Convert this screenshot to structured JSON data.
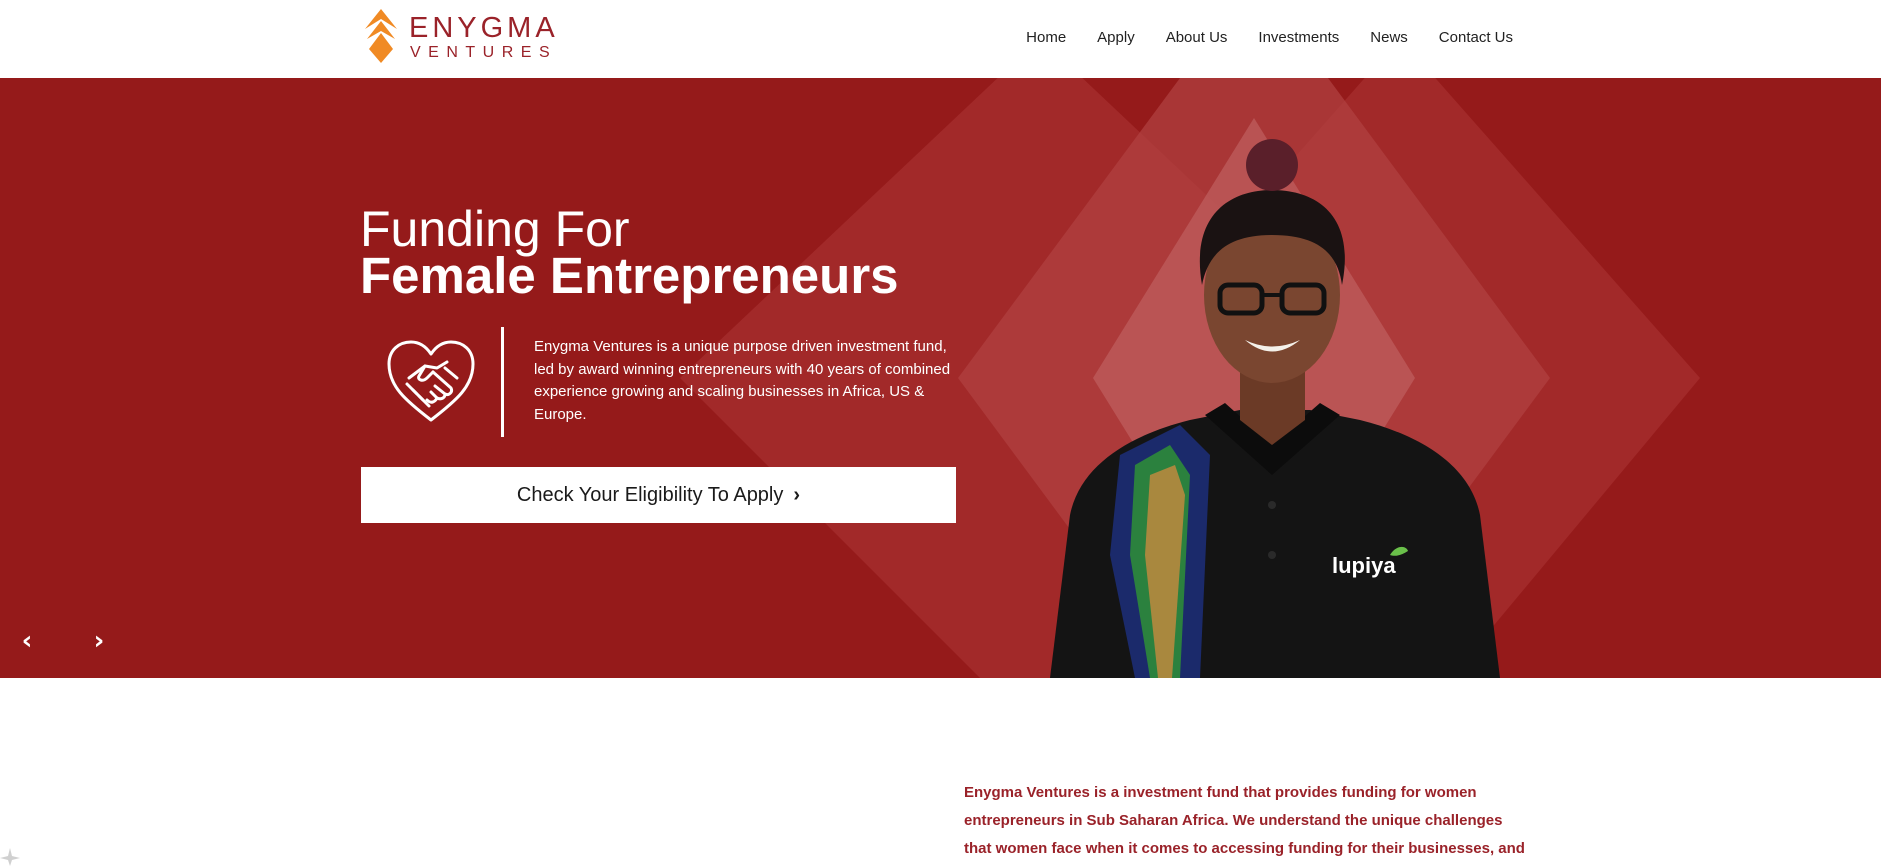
{
  "brand": {
    "name_line1": "ENYGMA",
    "name_line2": "VENTURES",
    "primary_color": "#951a1a",
    "accent_color": "#f08a24"
  },
  "nav": {
    "items": [
      {
        "label": "Home"
      },
      {
        "label": "Apply"
      },
      {
        "label": "About Us"
      },
      {
        "label": "Investments"
      },
      {
        "label": "News"
      },
      {
        "label": "Contact Us"
      }
    ]
  },
  "hero": {
    "title_line1": "Funding For",
    "title_line2": "Female Entrepreneurs",
    "icon": "handshake-heart-icon",
    "description": "Enygma Ventures is a unique purpose driven investment fund, led by award winning entrepreneurs with 40 years of combined experience growing and scaling businesses in Africa, US & Europe.",
    "cta_label": "Check Your Eligibility To Apply",
    "cta_icon": "chevron-right-icon",
    "prev_icon": "chevron-left-icon",
    "next_icon": "chevron-right-icon",
    "photo_shirt_text": "lupiya"
  },
  "intro": {
    "text": "Enygma Ventures is a investment fund that provides funding for women entrepreneurs in Sub Saharan Africa. We understand the unique challenges that women face when it comes to accessing funding for their businesses, and we"
  }
}
